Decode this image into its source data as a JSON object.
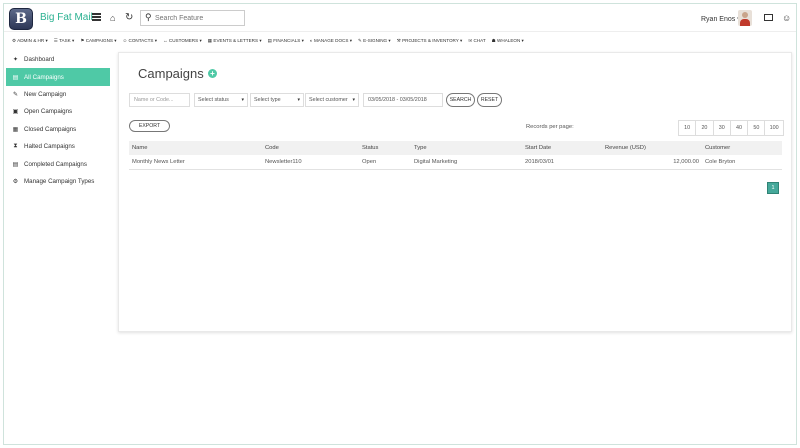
{
  "header": {
    "logo_letter": "B",
    "brand": "Big Fat Mail",
    "search_placeholder": "Search Feature",
    "user_name": "Ryan Enos ▾"
  },
  "topmenu": [
    "⚙ ADMIN & HR ▾",
    "☰ TASK ▾",
    "⚑ CAMPAIGNS ▾",
    "☺ CONTACTS ▾",
    "↔ CUSTOMERS ▾",
    "▦ EVENTS & LETTERS ▾",
    "▤ FINANCIALS ▾",
    "◐ MANAGE DOCS ▾",
    "✎ E-SIGNING ▾",
    "⚒ PROJECTS & INVENTORY ▾",
    "✉ CHAT",
    "☗ WHALEON ▾"
  ],
  "sidebar": {
    "items": [
      {
        "label": "Dashboard",
        "icon": "✦"
      },
      {
        "label": "All Campaigns",
        "icon": "▤"
      },
      {
        "label": "New Campaign",
        "icon": "✎"
      },
      {
        "label": "Open Campaigns",
        "icon": "▣"
      },
      {
        "label": "Closed Campaigns",
        "icon": "▦"
      },
      {
        "label": "Halted Campaigns",
        "icon": "⧗"
      },
      {
        "label": "Completed Campaigns",
        "icon": "▤"
      },
      {
        "label": "Manage Campaign Types",
        "icon": "⚙"
      }
    ]
  },
  "main": {
    "title": "Campaigns",
    "filters": {
      "name_placeholder": "Name or Code...",
      "status": "Select status",
      "type": "Select type",
      "customer": "Select customer",
      "date_range": "03/05/2018 - 03/05/2018",
      "search_label": "SEARCH",
      "reset_label": "RESET"
    },
    "export_label": "EXPORT",
    "records_per_page_label": "Records per page:",
    "page_sizes": [
      "10",
      "20",
      "30",
      "40",
      "50",
      "100"
    ],
    "columns": [
      "Name",
      "Code",
      "Status",
      "Type",
      "Start Date",
      "Revenue (USD)",
      "Customer"
    ],
    "rows": [
      [
        "Monthly News Letter",
        "Newsletter110",
        "Open",
        "Digital Marketing",
        "2018/03/01",
        "12,000.00",
        "Cole Bryton"
      ]
    ],
    "current_page": "1"
  },
  "colors": {
    "accent": "#4fc9a6",
    "brand_text": "#2bb191",
    "pager": "#45a89a"
  }
}
